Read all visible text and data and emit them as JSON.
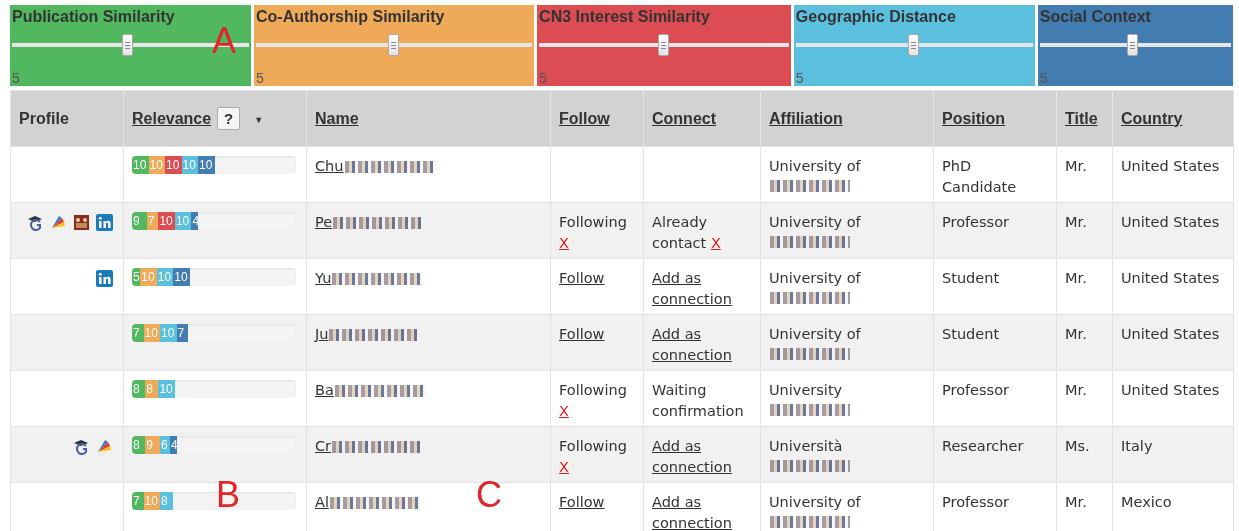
{
  "sliders": [
    {
      "label": "Publication Similarity",
      "color": "#52b85f",
      "level": 0.49,
      "value": "5"
    },
    {
      "label": "Co-Authorship Similarity",
      "color": "#eeaa58",
      "level": 0.5,
      "value": "5"
    },
    {
      "label": "CN3 Interest Similarity",
      "color": "#dc4c53",
      "level": 0.5,
      "value": "5"
    },
    {
      "label": "Geographic Distance",
      "color": "#5bc0de",
      "level": 0.5,
      "value": "5"
    },
    {
      "label": "Social Context",
      "color": "#437cb0",
      "level": 0.49,
      "value": "5"
    }
  ],
  "table": {
    "columns": [
      {
        "label": "Profile",
        "kind": "plain"
      },
      {
        "label": "Relevance",
        "kind": "sortable",
        "help": "?",
        "sort_caret": "▼"
      },
      {
        "label": "Name",
        "kind": "link"
      },
      {
        "label": "Follow",
        "kind": "link"
      },
      {
        "label": "Connect",
        "kind": "link"
      },
      {
        "label": "Affiliation",
        "kind": "link"
      },
      {
        "label": "Position",
        "kind": "link"
      },
      {
        "label": "Title",
        "kind": "link"
      },
      {
        "label": "Country",
        "kind": "link"
      }
    ],
    "rows": [
      {
        "profiles": [],
        "relevance": [
          {
            "value": "10",
            "color": "#52b85f"
          },
          {
            "value": "10",
            "color": "#eeaa58"
          },
          {
            "value": "10",
            "color": "#dc4c53"
          },
          {
            "value": "10",
            "color": "#5bc0de"
          },
          {
            "value": "10",
            "color": "#437cb0"
          }
        ],
        "name": {
          "text": "Chu",
          "redacted": true
        },
        "affiliation": {
          "lines": [
            "University of"
          ],
          "redacted": true
        },
        "position": "PhD Candidate",
        "title": "Mr.",
        "country": "United States"
      },
      {
        "profiles": [
          {
            "kind": "scholar"
          },
          {
            "kind": "fan"
          },
          {
            "kind": "group"
          },
          {
            "kind": "linkedin"
          }
        ],
        "relevance": [
          {
            "value": "9",
            "color": "#52b85f"
          },
          {
            "value": "7",
            "color": "#eeaa58"
          },
          {
            "value": "10",
            "color": "#dc4c53"
          },
          {
            "value": "10",
            "color": "#5bc0de"
          },
          {
            "value": "4",
            "color": "#437cb0"
          }
        ],
        "name": {
          "text": "Pe",
          "redacted": true
        },
        "follow": {
          "text": "Following",
          "link": false,
          "remove": "X"
        },
        "connect": {
          "text": "Already contact",
          "link": false,
          "remove": "X"
        },
        "affiliation": {
          "lines": [
            "University of"
          ],
          "redacted": true
        },
        "position": "Professor",
        "title": "Mr.",
        "country": "United States"
      },
      {
        "profiles": [
          {
            "kind": "linkedin"
          }
        ],
        "relevance": [
          {
            "value": "5",
            "color": "#52b85f"
          },
          {
            "value": "10",
            "color": "#eeaa58"
          },
          {
            "value": "10",
            "color": "#5bc0de"
          },
          {
            "value": "10",
            "color": "#437cb0"
          }
        ],
        "name": {
          "text": "Yu",
          "redacted": true
        },
        "follow": {
          "text": "Follow",
          "link": true
        },
        "connect": {
          "text": "Add as connection",
          "link": true
        },
        "affiliation": {
          "lines": [
            "University of"
          ],
          "redacted": true
        },
        "position": "Student",
        "title": "Mr.",
        "country": "United States"
      },
      {
        "profiles": [],
        "relevance": [
          {
            "value": "7",
            "color": "#52b85f"
          },
          {
            "value": "10",
            "color": "#eeaa58"
          },
          {
            "value": "10",
            "color": "#5bc0de"
          },
          {
            "value": "7",
            "color": "#437cb0"
          }
        ],
        "name": {
          "text": "Ju",
          "redacted": true
        },
        "follow": {
          "text": "Follow",
          "link": true
        },
        "connect": {
          "text": "Add as connection",
          "link": true
        },
        "affiliation": {
          "lines": [
            "University of"
          ],
          "redacted": true
        },
        "position": "Student",
        "title": "Mr.",
        "country": "United States"
      },
      {
        "profiles": [],
        "relevance": [
          {
            "value": "8",
            "color": "#52b85f"
          },
          {
            "value": "8",
            "color": "#eeaa58"
          },
          {
            "value": "10",
            "color": "#5bc0de"
          }
        ],
        "name": {
          "text": "Ba",
          "redacted": true
        },
        "follow": {
          "text": "Following",
          "link": false,
          "remove": "X"
        },
        "connect": {
          "text": "Waiting confirmation",
          "link": false
        },
        "affiliation": {
          "lines": [
            "University"
          ],
          "redacted": true
        },
        "position": "Professor",
        "title": "Mr.",
        "country": "United States"
      },
      {
        "profiles": [
          {
            "kind": "scholar"
          },
          {
            "kind": "fan"
          }
        ],
        "relevance": [
          {
            "value": "8",
            "color": "#52b85f"
          },
          {
            "value": "9",
            "color": "#eeaa58"
          },
          {
            "value": "6",
            "color": "#5bc0de"
          },
          {
            "value": "4",
            "color": "#437cb0"
          }
        ],
        "name": {
          "text": "Cr",
          "redacted": true
        },
        "follow": {
          "text": "Following",
          "link": false,
          "remove": "X"
        },
        "connect": {
          "text": "Add as connection",
          "link": true
        },
        "affiliation": {
          "lines": [
            "Università"
          ],
          "redacted": true
        },
        "position": "Researcher",
        "title": "Ms.",
        "country": "Italy"
      },
      {
        "profiles": [],
        "relevance": [
          {
            "value": "7",
            "color": "#52b85f"
          },
          {
            "value": "10",
            "color": "#eeaa58"
          },
          {
            "value": "8",
            "color": "#5bc0de"
          }
        ],
        "name": {
          "text": "Al",
          "redacted": true
        },
        "follow": {
          "text": "Follow",
          "link": true
        },
        "connect": {
          "text": "Add as connection",
          "link": true
        },
        "affiliation": {
          "lines": [
            "University of"
          ],
          "redacted": true
        },
        "position": "Professor",
        "title": "Mr.",
        "country": "Mexico"
      }
    ]
  },
  "annotations": [
    {
      "label": "A"
    },
    {
      "label": "B"
    },
    {
      "label": "C"
    }
  ]
}
